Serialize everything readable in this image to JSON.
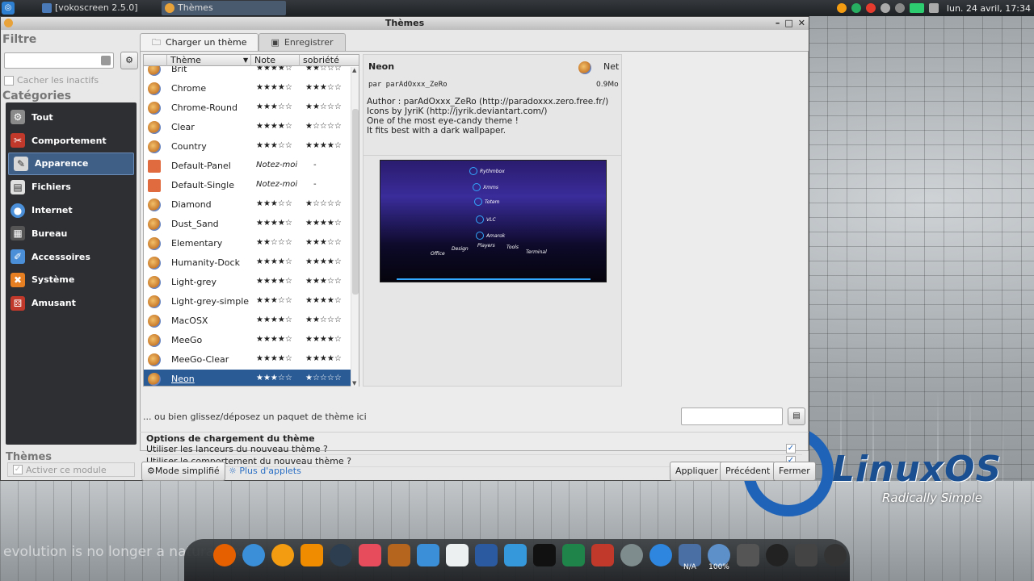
{
  "panel": {
    "tasks": [
      {
        "label": "[vokoscreen 2.5.0]",
        "active": false
      },
      {
        "label": "Thèmes",
        "active": true
      }
    ],
    "clock": "lun. 24 avril, 17:34"
  },
  "window": {
    "title": "Thèmes"
  },
  "left": {
    "filter_heading": "Filtre",
    "hide_inactive": "Cacher les inactifs",
    "categories_heading": "Catégories",
    "categories": [
      {
        "label": "Tout",
        "icon": "gears-icon",
        "color": "#8a8a8a"
      },
      {
        "label": "Comportement",
        "icon": "tools-icon",
        "color": "#c0392b"
      },
      {
        "label": "Apparence",
        "icon": "brush-icon",
        "color": "#d8d8d8",
        "selected": true
      },
      {
        "label": "Fichiers",
        "icon": "files-icon",
        "color": "#e0e0e0"
      },
      {
        "label": "Internet",
        "icon": "globe-icon",
        "color": "#4a8fd8"
      },
      {
        "label": "Bureau",
        "icon": "desktop-icon",
        "color": "#555"
      },
      {
        "label": "Accessoires",
        "icon": "accessories-icon",
        "color": "#4a8fd8"
      },
      {
        "label": "Système",
        "icon": "system-icon",
        "color": "#e67e22"
      },
      {
        "label": "Amusant",
        "icon": "dice-icon",
        "color": "#c0392b"
      }
    ],
    "module_heading": "Thèmes",
    "activate_module": "Activer ce module"
  },
  "tabs": [
    {
      "label": "Charger un thème",
      "active": true
    },
    {
      "label": "Enregistrer",
      "active": false
    }
  ],
  "list": {
    "headers": {
      "theme": "Thème",
      "note": "Note",
      "sobriety": "sobriété"
    },
    "rows": [
      {
        "name": "Brit",
        "note": "★★★★☆",
        "sobriety": "★★☆☆☆"
      },
      {
        "name": "Chrome",
        "note": "★★★★☆",
        "sobriety": "★★★☆☆"
      },
      {
        "name": "Chrome-Round",
        "note": "★★★☆☆",
        "sobriety": "★★☆☆☆"
      },
      {
        "name": "Clear",
        "note": "★★★★☆",
        "sobriety": "★☆☆☆☆"
      },
      {
        "name": "Country",
        "note": "★★★☆☆",
        "sobriety": "★★★★☆"
      },
      {
        "name": "Default-Panel",
        "note": "Notez-moi",
        "sobriety": "-",
        "home": true
      },
      {
        "name": "Default-Single",
        "note": "Notez-moi",
        "sobriety": "-",
        "home": true
      },
      {
        "name": "Diamond",
        "note": "★★★☆☆",
        "sobriety": "★☆☆☆☆"
      },
      {
        "name": "Dust_Sand",
        "note": "★★★★☆",
        "sobriety": "★★★★☆"
      },
      {
        "name": "Elementary",
        "note": "★★☆☆☆",
        "sobriety": "★★★☆☆"
      },
      {
        "name": "Humanity-Dock",
        "note": "★★★★☆",
        "sobriety": "★★★★☆"
      },
      {
        "name": "Light-grey",
        "note": "★★★★☆",
        "sobriety": "★★★☆☆"
      },
      {
        "name": "Light-grey-simple",
        "note": "★★★☆☆",
        "sobriety": "★★★★☆"
      },
      {
        "name": "MacOSX",
        "note": "★★★★☆",
        "sobriety": "★★☆☆☆"
      },
      {
        "name": "MeeGo",
        "note": "★★★★☆",
        "sobriety": "★★★★☆"
      },
      {
        "name": "MeeGo-Clear",
        "note": "★★★★☆",
        "sobriety": "★★★★☆"
      },
      {
        "name": "Neon",
        "note": "★★★☆☆",
        "sobriety": "★☆☆☆☆",
        "selected": true
      }
    ]
  },
  "detail": {
    "name": "Neon",
    "type": "Net",
    "author_line": "par parAdOxxx_ZeRo",
    "size": "0.9Mo",
    "description": "Author : parAdOxxx_ZeRo (http://paradoxxx.zero.free.fr/)\nIcons by JyriK (http://jyrik.deviantart.com/)\nOne of the most eye-candy theme !\nIt fits best with a dark wallpaper.",
    "preview_items": [
      "Rythmbox",
      "Xmms",
      "Totem",
      "VLC",
      "Amarok"
    ],
    "preview_labels": [
      "Office",
      "Design",
      "Players",
      "Tools",
      "Terminal"
    ]
  },
  "drop_text": "... ou bien glissez/déposez un paquet de thème ici",
  "options": {
    "heading": "Options de chargement du thème",
    "items": [
      "Utiliser les lanceurs du nouveau thème ?",
      "Utiliser le comportement du nouveau thème ?"
    ]
  },
  "footer": {
    "simple_mode": "Mode simplifié",
    "more_applets": "Plus d'applets",
    "apply": "Appliquer",
    "previous": "Précédent",
    "close": "Fermer"
  },
  "desktop": {
    "brand": "LinuxOS",
    "tagline": "Radically Simple",
    "ticker": "evolution is no longer a natural proc",
    "dock_labels": [
      "N/A",
      "100%"
    ]
  }
}
